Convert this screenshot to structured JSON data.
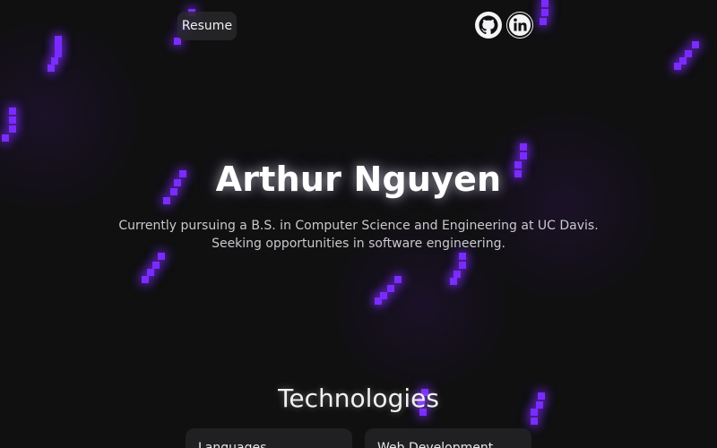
{
  "nav": {
    "resume_label": "Resume",
    "social": [
      {
        "icon": "github-icon"
      },
      {
        "icon": "linkedin-icon"
      }
    ]
  },
  "hero": {
    "name": "Arthur Nguyen",
    "subtitle_line1": "Currently pursuing a B.S. in Computer Science and Engineering at UC Davis.",
    "subtitle_line2": "Seeking opportunities in software engineering."
  },
  "technologies": {
    "title": "Technologies",
    "cards": [
      {
        "label": "Languages"
      },
      {
        "label": "Web Development"
      }
    ]
  },
  "colors": {
    "background": "#101011",
    "accent": "#7b2cff",
    "text": "#ffffff"
  }
}
